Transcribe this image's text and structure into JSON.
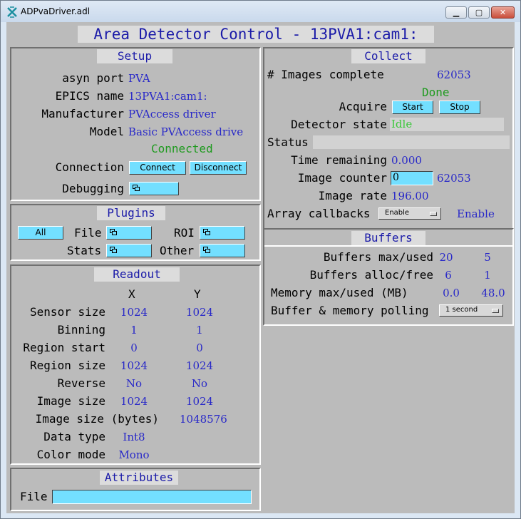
{
  "window": {
    "title": "ADPvaDriver.adl",
    "min": "▁",
    "max": "▢",
    "close": "✕"
  },
  "header": {
    "title": "Area Detector Control - 13PVA1:cam1:"
  },
  "setup": {
    "title": "Setup",
    "asyn_port_label": "asyn port",
    "asyn_port": "PVA",
    "epics_name_label": "EPICS name",
    "epics_name": "13PVA1:cam1:",
    "manufacturer_label": "Manufacturer",
    "manufacturer": "PVAccess driver",
    "model_label": "Model",
    "model": "Basic PVAccess drive",
    "status": "Connected",
    "connection_label": "Connection",
    "connect": "Connect",
    "disconnect": "Disconnect",
    "debugging_label": "Debugging"
  },
  "plugins": {
    "title": "Plugins",
    "all": "All",
    "file": "File",
    "roi": "ROI",
    "stats": "Stats",
    "other": "Other"
  },
  "readout": {
    "title": "Readout",
    "x": "X",
    "y": "Y",
    "rows": [
      {
        "label": "Sensor size",
        "x": "1024",
        "y": "1024"
      },
      {
        "label": "Binning",
        "x": "1",
        "y": "1"
      },
      {
        "label": "Region start",
        "x": "0",
        "y": "0"
      },
      {
        "label": "Region size",
        "x": "1024",
        "y": "1024"
      },
      {
        "label": "Reverse",
        "x": "No",
        "y": "No"
      },
      {
        "label": "Image size",
        "x": "1024",
        "y": "1024"
      }
    ],
    "bytes_label": "Image size (bytes)",
    "bytes": "1048576",
    "data_type_label": "Data type",
    "data_type": "Int8",
    "color_mode_label": "Color mode",
    "color_mode": "Mono"
  },
  "attributes": {
    "title": "Attributes",
    "file_label": "File",
    "file_value": ""
  },
  "collect": {
    "title": "Collect",
    "images_complete_label": "# Images complete",
    "images_complete": "62053",
    "acquire_status": "Done",
    "acquire_label": "Acquire",
    "start": "Start",
    "stop": "Stop",
    "detector_state_label": "Detector state",
    "detector_state": "Idle",
    "status_label": "Status",
    "status_value": "",
    "time_remaining_label": "Time remaining",
    "time_remaining": "0.000",
    "image_counter_label": "Image counter",
    "image_counter_input": "0",
    "image_counter": "62053",
    "image_rate_label": "Image rate",
    "image_rate": "196.00",
    "array_callbacks_label": "Array callbacks",
    "array_callbacks_menu": "Enable",
    "array_callbacks": "Enable"
  },
  "buffers": {
    "title": "Buffers",
    "max_used_label": "Buffers max/used",
    "max": "20",
    "used": "5",
    "alloc_free_label": "Buffers alloc/free",
    "alloc": "6",
    "free": "1",
    "memory_label": "Memory max/used (MB)",
    "mem_max": "0.0",
    "mem_used": "48.0",
    "polling_label": "Buffer & memory polling",
    "polling": "1 second"
  },
  "colors": {
    "background": "#bbbbbb",
    "button": "#73dfff",
    "text_value": "#2828c8",
    "text_ok": "#1e9a1e",
    "title_text": "#1a1aa8"
  },
  "icons": [
    "app-icon",
    "related-display-icon",
    "menu-arrow-icon"
  ]
}
